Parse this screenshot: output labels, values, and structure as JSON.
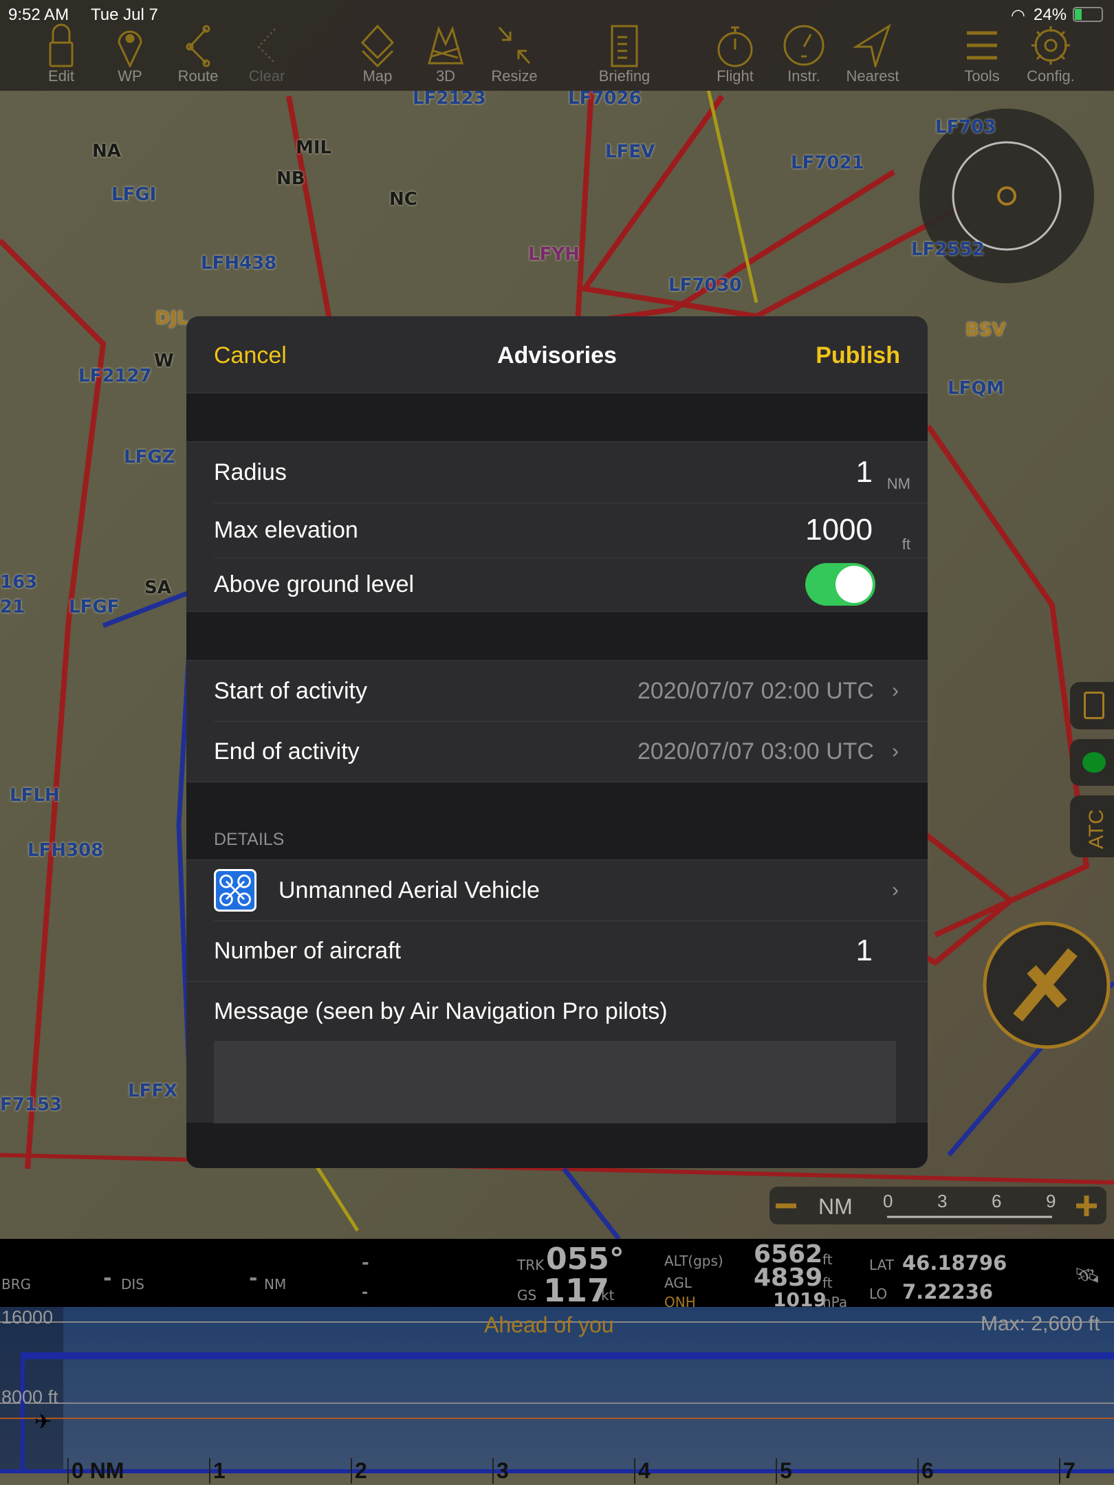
{
  "status": {
    "time": "9:52 AM",
    "date": "Tue Jul 7",
    "battery": "24%"
  },
  "toolbar": [
    {
      "label": "Edit",
      "icon": "lock-icon",
      "enabled": true
    },
    {
      "label": "WP",
      "icon": "pin-icon",
      "enabled": true
    },
    {
      "label": "Route",
      "icon": "route-icon",
      "enabled": true
    },
    {
      "label": "Clear",
      "icon": "clear-route-icon",
      "enabled": false
    },
    {
      "label": "Map",
      "icon": "layers-icon",
      "enabled": true
    },
    {
      "label": "3D",
      "icon": "terrain-3d-icon",
      "enabled": true
    },
    {
      "label": "Resize",
      "icon": "resize-icon",
      "enabled": true
    },
    {
      "label": "Briefing",
      "icon": "briefing-icon",
      "enabled": true
    },
    {
      "label": "Flight",
      "icon": "stopwatch-icon",
      "enabled": true
    },
    {
      "label": "Instr.",
      "icon": "gauge-icon",
      "enabled": true
    },
    {
      "label": "Nearest",
      "icon": "nearest-arrow-icon",
      "enabled": true
    },
    {
      "label": "Tools",
      "icon": "menu-icon",
      "enabled": true
    },
    {
      "label": "Config.",
      "icon": "gear-icon",
      "enabled": true
    }
  ],
  "map_labels": [
    "LF2123",
    "LF7026",
    "LFEV",
    "LF703",
    "NA",
    "NB",
    "MIL",
    "LFGI",
    "NC",
    "LF7021",
    "LFH438",
    "LFYH",
    "LF2552",
    "LF7030",
    "DJL",
    "W",
    "BSV",
    "LF2127",
    "LFQM",
    "LFGZ",
    "SA",
    "LFGF",
    "163",
    "21",
    "LFLH",
    "LFH308",
    "LFFX",
    "F7153"
  ],
  "map_scale": {
    "unit": "NM",
    "ticks": [
      "0",
      "3",
      "6",
      "9"
    ]
  },
  "side_buttons": {
    "atc": "ATC"
  },
  "dialog": {
    "cancel": "Cancel",
    "title": "Advisories",
    "publish": "Publish",
    "radius": {
      "label": "Radius",
      "value": "1",
      "unit": "NM"
    },
    "max_elevation": {
      "label": "Max elevation",
      "value": "1000",
      "unit": "ft"
    },
    "agl": {
      "label": "Above ground level",
      "on": true
    },
    "start": {
      "label": "Start of activity",
      "value": "2020/07/07 02:00 UTC"
    },
    "end": {
      "label": "End of activity",
      "value": "2020/07/07 03:00 UTC"
    },
    "details_header": "DETAILS",
    "aircraft_type": "Unmanned Aerial Vehicle",
    "count": {
      "label": "Number of aircraft",
      "value": "1"
    },
    "message": {
      "label": "Message (seen by Air Navigation Pro pilots)",
      "value": ""
    }
  },
  "info": {
    "brg": "BRG",
    "dis_val": "-",
    "dis": "DIS",
    "nm_val": "-",
    "nm": "NM",
    "dash1": "-",
    "dash2": "-",
    "trk_label": "TRK",
    "trk": "055°",
    "gs_label": "GS",
    "gs": "117",
    "gs_unit": "kt",
    "alt_label": "ALT(gps)",
    "alt": "6562",
    "alt_unit": "ft",
    "agl_label": "AGL",
    "agl": "4839",
    "agl_unit": "ft",
    "qnh_label": "QNH",
    "qnh": "1019",
    "qnh_unit": "hPa",
    "lat_label": "LAT",
    "lat": "46.18796",
    "lo_label": "LO",
    "lo": "7.22236"
  },
  "profile": {
    "top": "16000",
    "mid": "8000 ft",
    "title": "Ahead of you",
    "max": "Max: 2,600 ft",
    "ticks": [
      "0 NM",
      "1",
      "2",
      "3",
      "4",
      "5",
      "6",
      "7"
    ]
  }
}
